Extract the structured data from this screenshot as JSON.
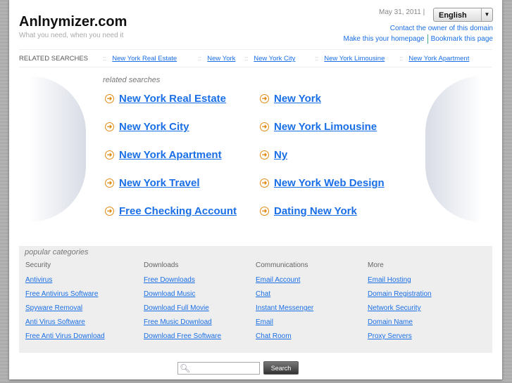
{
  "header": {
    "title": "Anlnymizer.com",
    "tagline": "What you need, when you need it",
    "date": "May 31, 2011 |",
    "language": "English",
    "contact": "Contact the owner of this domain",
    "homepage": "Make this your homepage",
    "bookmark": "Bookmark this page"
  },
  "related_bar": {
    "label": "RELATED SEARCHES",
    "sep": "::",
    "items": [
      "New York Real Estate",
      "New York",
      "New York City",
      "New York Limousine",
      "New York Apartment"
    ]
  },
  "related": {
    "heading": "related searches",
    "items": [
      "New York Real Estate",
      "New York",
      "New York City",
      "New York Limousine",
      "New York Apartment",
      "Ny",
      "New York Travel",
      "New York Web Design",
      "Free Checking Account",
      "Dating New York"
    ]
  },
  "popular": {
    "heading": "popular categories",
    "columns": [
      {
        "title": "Security",
        "links": [
          "Antivirus",
          "Free Antivirus Software",
          "Spyware Removal",
          "Anti Virus Software",
          "Free Anti Virus Download"
        ]
      },
      {
        "title": "Downloads",
        "links": [
          "Free Downloads",
          "Download Music",
          "Download Full Movie",
          "Free Music Download",
          "Download Free Software"
        ]
      },
      {
        "title": "Communications",
        "links": [
          "Email Account",
          "Chat",
          "Instant Messenger",
          "Email",
          "Chat Room"
        ]
      },
      {
        "title": "More",
        "links": [
          "Email Hosting",
          "Domain Registration",
          "Network Security",
          "Domain Name",
          "Proxy Servers"
        ]
      }
    ]
  },
  "search": {
    "value": "",
    "button": "Search"
  }
}
